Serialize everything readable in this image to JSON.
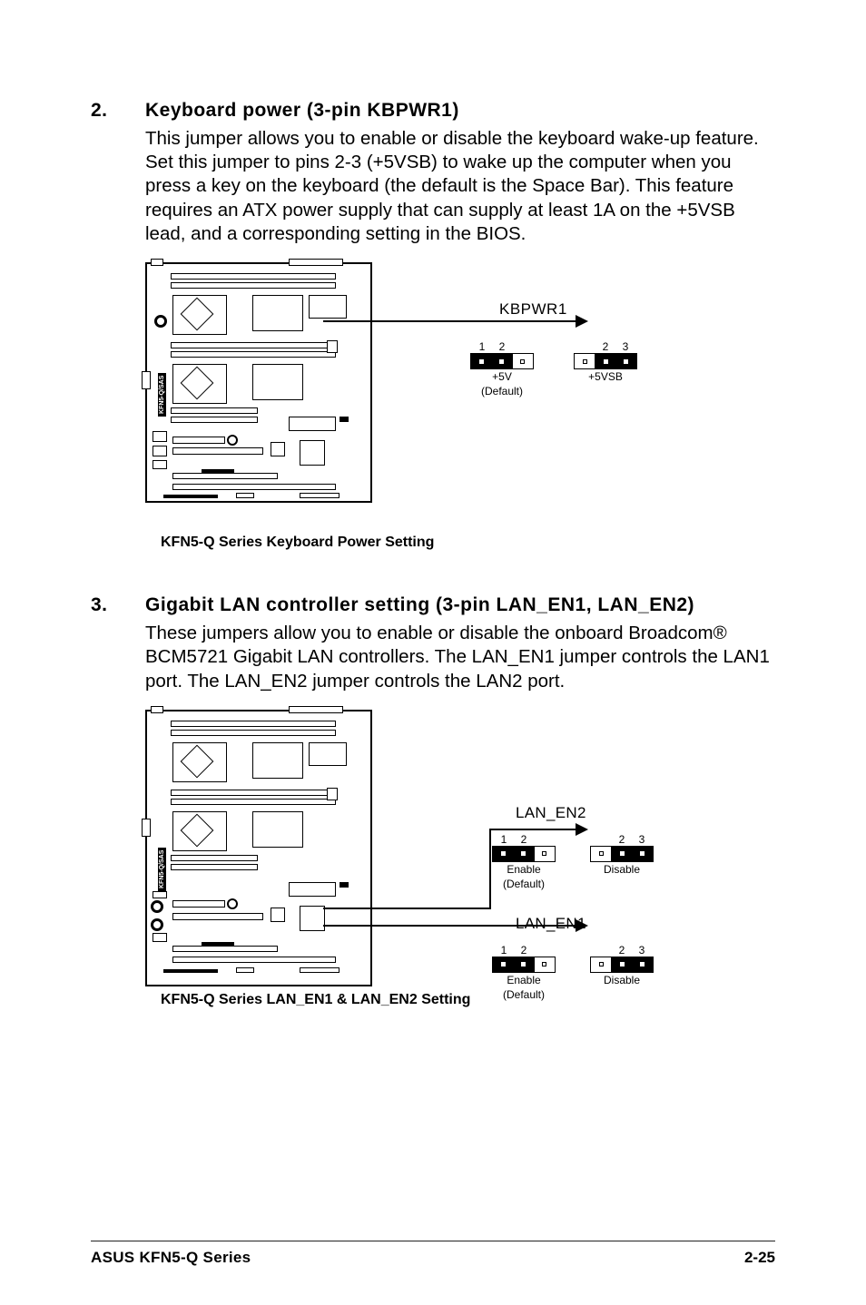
{
  "items": [
    {
      "num": "2.",
      "title": "Keyboard power (3-pin KBPWR1)",
      "body": "This jumper allows you to enable or disable the keyboard wake-up feature. Set this jumper to pins 2-3 (+5VSB) to wake up the computer when you press a key on the keyboard (the default is the Space Bar). This feature requires an ATX power supply that can supply at least 1A on the +5VSB lead, and a corresponding setting in the BIOS."
    },
    {
      "num": "3.",
      "title": "Gigabit LAN controller setting (3-pin LAN_EN1, LAN_EN2)",
      "body": "These jumpers allow you to enable or disable the onboard Broadcom® BCM5721 Gigabit LAN controllers. The LAN_EN1 jumper controls the LAN1 port. The LAN_EN2 jumper controls the LAN2 port."
    }
  ],
  "diag1": {
    "header_label": "KBPWR1",
    "jumper_a": {
      "pin_left": "1",
      "pin_right": "2",
      "sub1": "+5V",
      "sub2": "(Default)"
    },
    "jumper_b": {
      "pin_left": "2",
      "pin_right": "3",
      "sub1": "+5VSB",
      "sub2": ""
    },
    "caption": "KFN5-Q Series Keyboard Power Setting",
    "model": "KFN5-Q/SAS"
  },
  "diag2": {
    "label_top": "LAN_EN2",
    "label_bottom": "LAN_EN1",
    "jumper_en_a": {
      "pin_left": "1",
      "pin_right": "2",
      "sub1": "Enable",
      "sub2": "(Default)"
    },
    "jumper_dis_a": {
      "pin_left": "2",
      "pin_right": "3",
      "sub1": "Disable",
      "sub2": ""
    },
    "jumper_en_b": {
      "pin_left": "1",
      "pin_right": "2",
      "sub1": "Enable",
      "sub2": "(Default)"
    },
    "jumper_dis_b": {
      "pin_left": "2",
      "pin_right": "3",
      "sub1": "Disable",
      "sub2": ""
    },
    "caption": "KFN5-Q Series LAN_EN1 & LAN_EN2 Setting",
    "model": "KFN5-Q/SAS"
  },
  "footer": {
    "left": "ASUS KFN5-Q Series",
    "right": "2-25"
  }
}
